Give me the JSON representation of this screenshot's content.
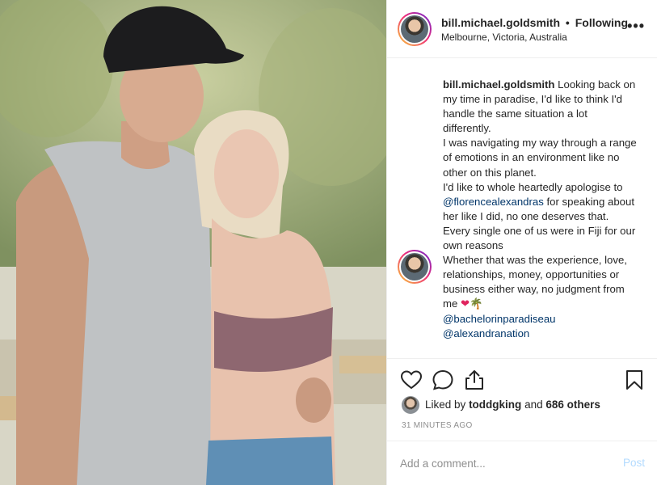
{
  "post": {
    "username": "bill.michael.goldsmith",
    "separator": "•",
    "follow_status": "Following",
    "location": "Melbourne, Victoria, Australia",
    "more_icon": "more-options-icon"
  },
  "caption": {
    "username": "bill.michael.goldsmith",
    "lines": [
      "Looking back on my time in paradise, I'd like to think I'd handle the same situation a lot differently.",
      "I was navigating my way through a range of emotions in an environment like no other on this planet.",
      "I'd like to whole heartedly apologise to",
      "@florencealexandras",
      "for speaking about her like I did, no one deserves that.",
      "Every single one of us were in Fiji for our own reasons",
      "Whether that was the experience, love, relationships, money, opportunities or business either way, no judgment from me",
      "❤",
      "🌴"
    ],
    "mentions": [
      "@bachelorinparadiseau",
      "@alexandranation"
    ]
  },
  "actions": {
    "icons": [
      "heart-icon",
      "comment-icon",
      "share-icon",
      "bookmark-icon"
    ]
  },
  "likes": {
    "prefix": "Liked by",
    "user": "toddgking",
    "and": "and",
    "others": "686 others"
  },
  "timestamp": "31 MINUTES AGO",
  "comment_box": {
    "placeholder": "Add a comment...",
    "post_label": "Post"
  },
  "colors": {
    "link": "#003569",
    "muted": "#8e8e8e",
    "post_disabled": "#b3dbff",
    "border": "#efefef"
  }
}
